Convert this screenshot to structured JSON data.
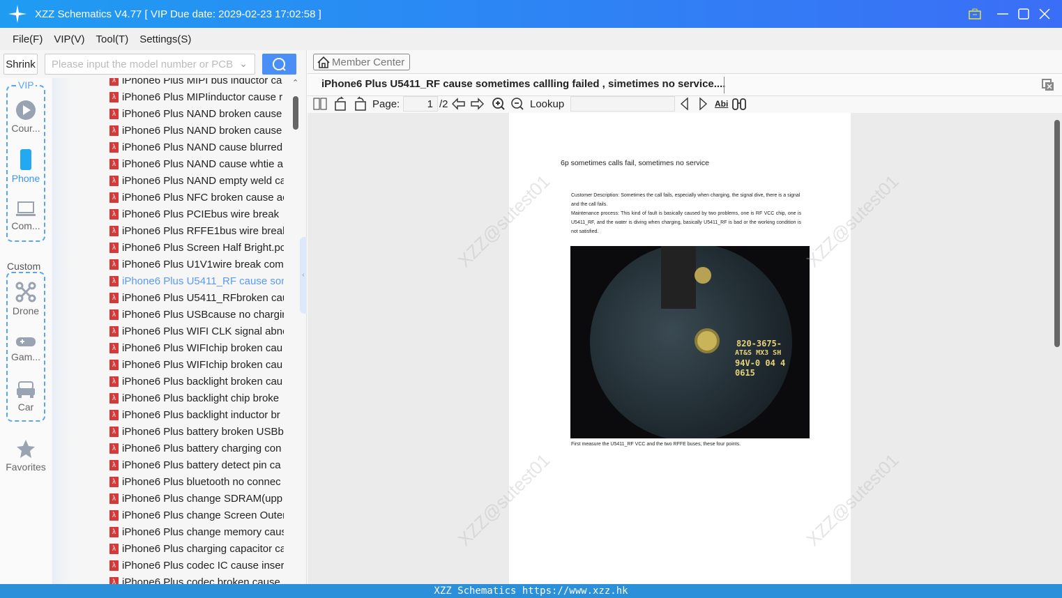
{
  "titlebar": {
    "title": "XZZ Schematics V4.77 [ VIP Due date: 2029-02-23 17:02:58 ]"
  },
  "menu": [
    "File(F)",
    "VIP(V)",
    "Tool(T)",
    "Settings(S)"
  ],
  "left": {
    "shrink": "Shrink",
    "search_placeholder": "Please input the model number or PCB"
  },
  "nav": {
    "vip_label": "VIP",
    "custom_label": "Custom",
    "items": [
      "Cour...",
      "Phone",
      "Com...",
      "Drone",
      "Gam...",
      "Car",
      "Favorites"
    ]
  },
  "list": [
    "iPhone6 Plus MIPI bus inductor ca",
    "iPhone6 Plus MIPIinductor cause r",
    "iPhone6 Plus NAND broken cause",
    "iPhone6 Plus NAND broken cause",
    "iPhone6 Plus NAND cause blurred",
    "iPhone6 Plus NAND cause whtie a",
    "iPhone6 Plus NAND empty weld ca",
    "iPhone6 Plus NFC broken cause ac",
    "iPhone6 Plus PCIEbus wire break",
    "iPhone6 Plus RFFE1bus wire break",
    "iPhone6 Plus Screen Half Bright.pc",
    "iPhone6 Plus U1V1wire break  com",
    "iPhone6 Plus U5411_RF cause som",
    "iPhone6 Plus U5411_RFbroken cau",
    "iPhone6 Plus USBcause no chargir",
    "iPhone6 Plus WIFI CLK signal abnc",
    "iPhone6 Plus WIFIchip broken cau",
    "iPhone6 Plus WIFIchip broken cau",
    "iPhone6 Plus backlight broken cau",
    "iPhone6 Plus backlight chip broke",
    "iPhone6 Plus backlight inductor br",
    "iPhone6 Plus battery broken USBb",
    "iPhone6 Plus battery charging con",
    "iPhone6 Plus battery detect pin ca",
    "iPhone6 Plus bluetooth no connec",
    "iPhone6 Plus change SDRAM(upp",
    "iPhone6 Plus change Screen Outer",
    "iPhone6 Plus change memory caus",
    "iPhone6 Plus charging capacitor ca",
    "iPhone6 Plus codec IC cause insert",
    "iPhone6 Plus codec broken cause"
  ],
  "selected_index": 12,
  "right": {
    "member_center": "Member Center",
    "doc_title": "iPhone6 Plus U5411_RF cause sometimes callling failed  , simetimes no service....",
    "page_label": "Page:",
    "page_current": "1",
    "page_total": "/2",
    "lookup_label": "Lookup",
    "lookup_value": ""
  },
  "doc": {
    "heading": "6p sometimes calls fail, sometimes no service",
    "para1": "Customer Description: Sometimes the call fails, especially when charging, the signal dive, there is a signal and the call fails.",
    "para2": "Maintenance process: This kind of fault is basically caused by two problems, one is RF VCC chip, one is U5411_RF, and the water is diving when charging, basically U5411_RF is bad or the working condition is not satisfied.",
    "photo_text": [
      "820-3675-",
      "AT&S MX3 SH",
      "94V-0 04  4",
      "0615"
    ],
    "caption": "First measure the U5411_RF VCC and the two RFFE buses, these four points.",
    "watermark": "XZZ@sutest01"
  },
  "status": "XZZ Schematics https://www.xzz.hk"
}
